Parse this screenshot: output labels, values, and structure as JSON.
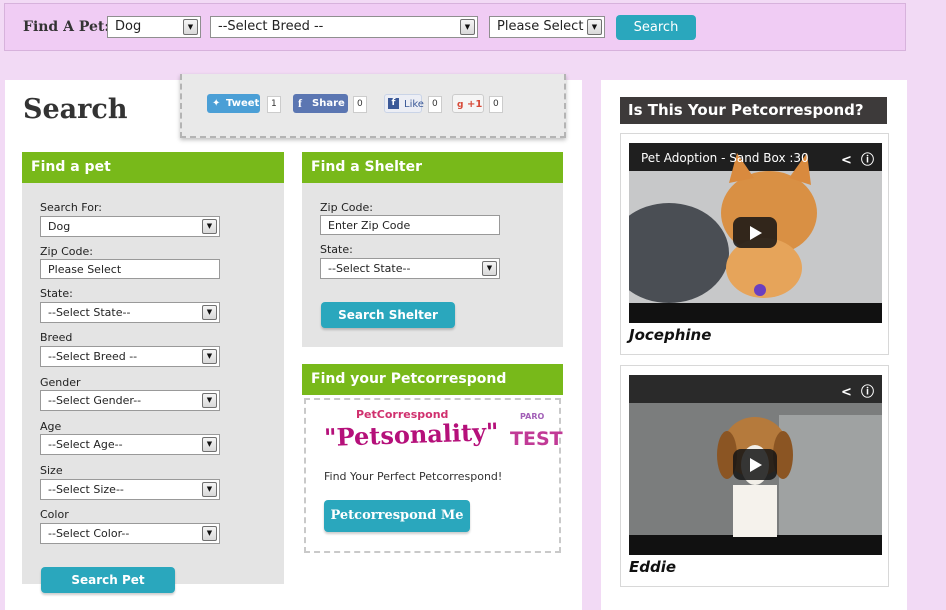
{
  "topbar": {
    "find_label": "Find A Pet:",
    "animal_select": "Dog",
    "breed_select": "--Select Breed --",
    "please_select": "Please Select",
    "search_button": "Search"
  },
  "main": {
    "title": "Search",
    "share": {
      "tweet": "Tweet",
      "tweet_count": "1",
      "fb_share": "Share",
      "fb_share_count": "0",
      "like": "Like",
      "like_count": "0",
      "gplus": "+1",
      "gplus_count": "0"
    },
    "find_pet": {
      "heading": "Find a pet",
      "search_for_label": "Search For:",
      "search_for_value": "Dog",
      "zip_label": "Zip Code:",
      "zip_value": "Please Select",
      "state_label": "State:",
      "state_value": "--Select State--",
      "breed_label": "Breed",
      "breed_value": "--Select Breed --",
      "gender_label": "Gender",
      "gender_value": "--Select Gender--",
      "age_label": "Age",
      "age_value": "--Select Age--",
      "size_label": "Size",
      "size_value": "--Select Size--",
      "color_label": "Color",
      "color_value": "--Select Color--",
      "button": "Search Pet"
    },
    "find_shelter": {
      "heading": "Find a Shelter",
      "zip_label": "Zip Code:",
      "zip_placeholder": "Enter Zip Code",
      "state_label": "State:",
      "state_value": "--Select State--",
      "button": "Search Shelter"
    },
    "petcorrespond": {
      "heading": "Find your Petcorrespond",
      "logo_small": "PetCorrespond",
      "logo_big": "\"Petsonality\"",
      "logo_test": "TEST",
      "logo_badge": "PARO",
      "tagline": "Find Your Perfect Petcorrespond!",
      "button": "Petcorrespond Me"
    }
  },
  "right": {
    "heading": "Is This Your Petcorrespond?",
    "videos": [
      {
        "title": "Pet Adoption - Sand Box :30",
        "name": "Jocephine"
      },
      {
        "title": "",
        "name": "Eddie"
      }
    ]
  },
  "colors": {
    "accent_green": "#78b91a",
    "button_teal": "#2aa7bd",
    "page_bg": "#f2daf5"
  }
}
